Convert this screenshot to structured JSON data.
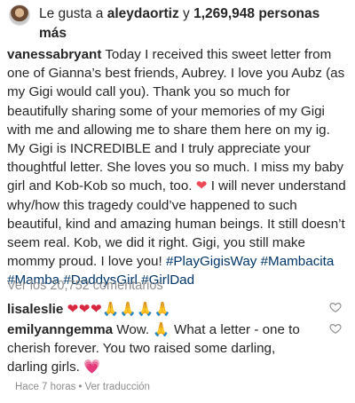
{
  "likes": {
    "prefix": "Le gusta a",
    "user": "aleydaortiz",
    "connector": "y",
    "count": "1,269,948 personas",
    "suffix": "más"
  },
  "caption": {
    "username": "vanessabryant",
    "text_1": "Today I received this sweet letter from one of Gianna’s best friends, Aubrey. I love you Aubz (as my Gigi would call you). Thank you so much for beautifully sharing some of your memories of my Gigi with me and allowing me to share them here on my ig. My Gigi is INCREDIBLE and I truly appreciate your thoughtful letter. She loves you so much. I miss my baby girl and Kob-Kob so much, too.",
    "heart": "❤",
    "text_2": "I will never understand why/how this tragedy could’ve happened to such beautiful, kind and amazing human beings. It still doesn’t seem real. Kob, we did it right. Gigi, you still make mommy proud. I love you!",
    "hashtags": [
      "#PlayGigisWay",
      "#Mambacita",
      "#Mamba",
      "#DaddysGirl",
      "#GirlDad"
    ]
  },
  "view_comments": "Ver los 20,752 comentarios",
  "comments": [
    {
      "username": "lisaleslie",
      "hearts": "❤❤❤",
      "hands": "🙏🙏🙏🙏"
    },
    {
      "username": "emilyanngemma",
      "text_a": "Wow.",
      "hands": "🙏",
      "text_b": "What a letter - one to cherish forever. You two raised some darling, darling girls.",
      "heart": "💗"
    }
  ],
  "meta": {
    "time": "Hace 7 horas",
    "dot": "•",
    "translate": "Ver traducción"
  }
}
